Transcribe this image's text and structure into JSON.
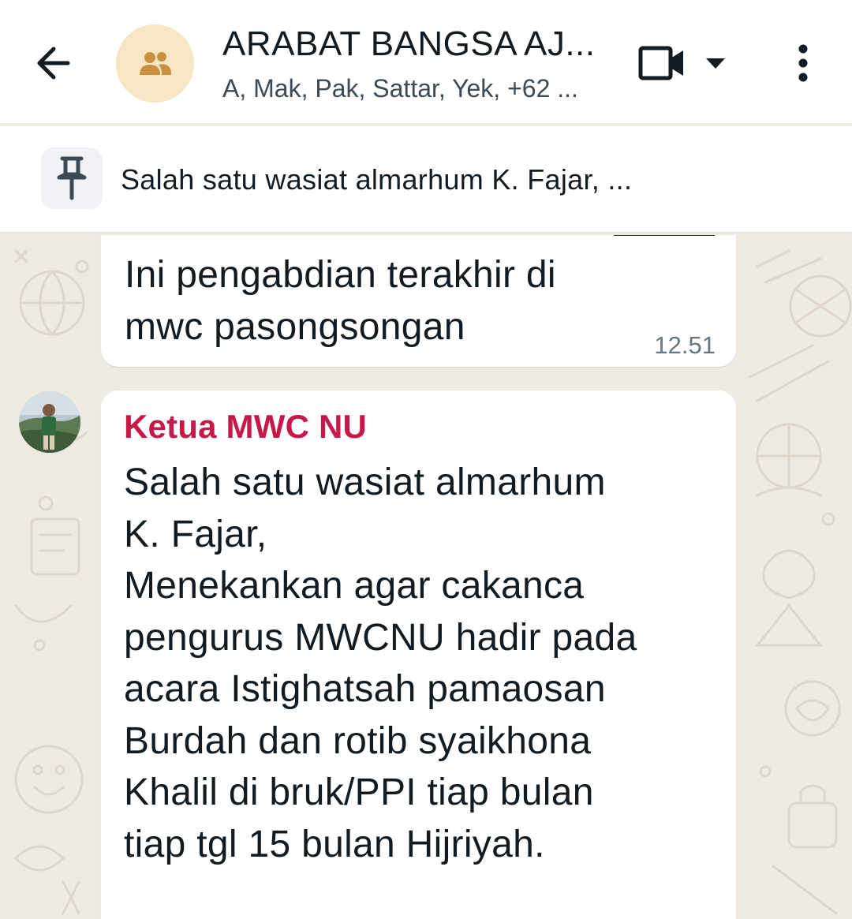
{
  "header": {
    "title": "ARABAT BANGSA AJ...",
    "subtitle": "A, Mak, Pak, Sattar, Yek, +62 ..."
  },
  "pinned": {
    "text": "Salah satu wasiat almarhum K. Fajar, ..."
  },
  "messages": [
    {
      "text": "Ini pengabdian terakhir di\nmwc pasongsongan",
      "time": "12.51"
    },
    {
      "sender": "Ketua MWC NU",
      "text": "Salah satu wasiat almarhum\nK. Fajar,\nMenekankan agar cakanca\npengurus MWCNU hadir pada\nacara Istighatsah pamaosan\nBurdah dan rotib syaikhona\nKhalil di bruk/PPI tiap bulan\ntiap tgl 15 bulan Hijriyah."
    }
  ],
  "colors": {
    "sender_name": "#c7184a",
    "chat_background": "#efeae2",
    "group_avatar_bg": "#f7e6c4",
    "group_avatar_icon": "#c9913f"
  },
  "icons": [
    "back-arrow-icon",
    "group-icon",
    "video-call-icon",
    "dropdown-caret-icon",
    "more-vert-icon",
    "pin-icon"
  ]
}
